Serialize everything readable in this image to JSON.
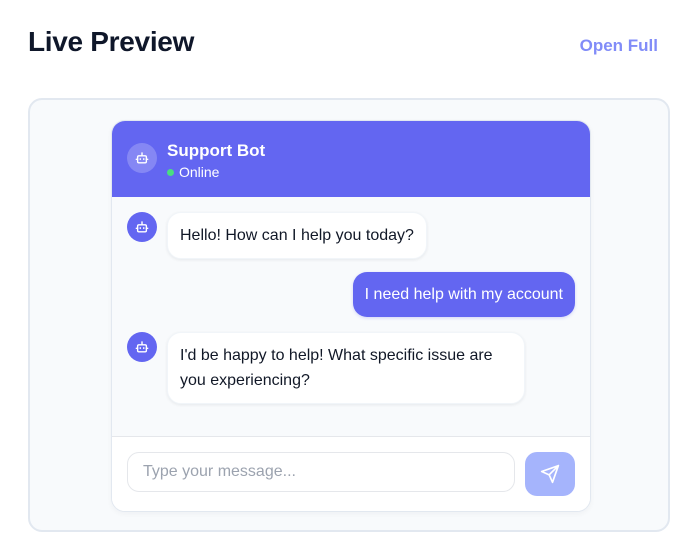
{
  "page": {
    "title": "Live Preview",
    "open_full_label": "Open Full"
  },
  "chat": {
    "bot_name": "Support Bot",
    "status": "Online",
    "header_color": "#6366f1",
    "status_color": "#4ade80",
    "messages": [
      {
        "sender": "bot",
        "text": "Hello! How can I help you today?"
      },
      {
        "sender": "user",
        "text": "I need help with my account"
      },
      {
        "sender": "bot",
        "text": "I'd be happy to help! What specific issue are you experiencing?"
      }
    ],
    "input": {
      "placeholder": "Type your message...",
      "value": ""
    },
    "send_icon": "send-icon",
    "avatar_icon": "robot-icon"
  },
  "colors": {
    "accent": "#6366f1",
    "accent_light": "#a5b4fc",
    "link": "#818cf8"
  }
}
